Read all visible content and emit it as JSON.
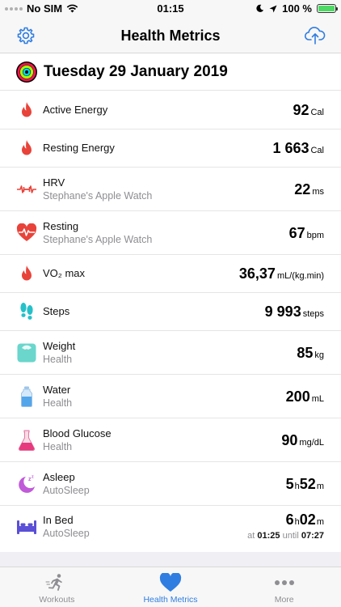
{
  "status_bar": {
    "carrier": "No SIM",
    "time": "01:15",
    "battery": "100 %"
  },
  "nav": {
    "title": "Health Metrics"
  },
  "date_header": "Tuesday 29 January 2019",
  "metrics": [
    {
      "label": "Active Energy",
      "value": "92",
      "unit": "Cal",
      "icon": "flame-icon"
    },
    {
      "label": "Resting Energy",
      "value": "1 663",
      "unit": "Cal",
      "icon": "flame-icon"
    },
    {
      "label": "HRV",
      "subtitle": "Stephane's Apple Watch",
      "value": "22",
      "unit": "ms",
      "icon": "hrv-icon"
    },
    {
      "label": "Resting",
      "subtitle": "Stephane's Apple Watch",
      "value": "67",
      "unit": "bpm",
      "icon": "heart-rate-icon"
    },
    {
      "label": "VO₂ max",
      "value": "36,37",
      "unit": "mL/(kg.min)",
      "icon": "flame-icon"
    },
    {
      "label": "Steps",
      "value": "9 993",
      "unit": "steps",
      "icon": "footprints-icon"
    },
    {
      "label": "Weight",
      "subtitle": "Health",
      "value": "85",
      "unit": "kg",
      "icon": "scale-icon"
    },
    {
      "label": "Water",
      "subtitle": "Health",
      "value": "200",
      "unit": "mL",
      "icon": "water-bottle-icon"
    },
    {
      "label": "Blood Glucose",
      "subtitle": "Health",
      "value": "90",
      "unit": "mg/dL",
      "icon": "flask-icon"
    },
    {
      "label": "Asleep",
      "subtitle": "AutoSleep",
      "h": "5",
      "h_unit": "h",
      "m": "52",
      "m_unit": "m",
      "icon": "moon-icon"
    },
    {
      "label": "In Bed",
      "subtitle": "AutoSleep",
      "h": "6",
      "h_unit": "h",
      "m": "02",
      "m_unit": "m",
      "at_label": "at",
      "start": "01:25",
      "until_label": "until",
      "end": "07:27",
      "icon": "bed-icon"
    }
  ],
  "tabs": [
    {
      "label": "Workouts",
      "icon": "running-icon"
    },
    {
      "label": "Health Metrics",
      "icon": "heart-icon",
      "active": true
    },
    {
      "label": "More",
      "icon": "more-dots-icon"
    }
  ],
  "colors": {
    "accent": "#2f7de1",
    "flame": "#e8433a",
    "heart": "#e8433a",
    "active_tab": "#2f7de1"
  }
}
